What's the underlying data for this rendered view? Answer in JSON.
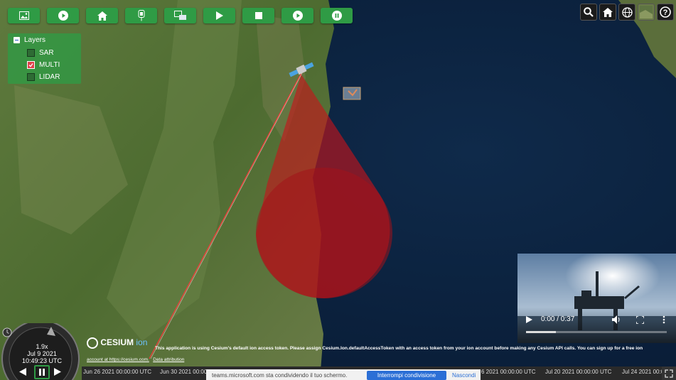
{
  "toolbar": {
    "buttons": [
      {
        "name": "image-icon"
      },
      {
        "name": "play-circle-icon"
      },
      {
        "name": "home-icon"
      },
      {
        "name": "sensor-icon"
      },
      {
        "name": "satellite-image-icon"
      },
      {
        "name": "play-icon"
      },
      {
        "name": "stop-icon"
      },
      {
        "name": "play-circle-icon"
      },
      {
        "name": "pause-circle-icon"
      }
    ],
    "color": "#2f9b45"
  },
  "nav_icons": [
    "search-icon",
    "home-icon",
    "globe-icon",
    "base-layer-picker-icon",
    "help-icon"
  ],
  "layers": {
    "title": "Layers",
    "items": [
      {
        "label": "SAR",
        "checked": false
      },
      {
        "label": "MULTI",
        "checked": true
      },
      {
        "label": "LIDAR",
        "checked": false
      }
    ]
  },
  "animation": {
    "speed": "1.9x",
    "date": "Jul 9 2021",
    "time": "10:49:23 UTC"
  },
  "cesium": {
    "logo_text": "CESIUM",
    "logo_suffix": "ion",
    "token_message": "This application is using Cesium's default ion access token. Please assign Cesium.Ion.defaultAccessToken with an access token from your ion account before making any Cesium API calls. You can sign up for a free ion",
    "account_link": "account at https://cesium.com.",
    "data_attribution": "Data attribution"
  },
  "video": {
    "time": "0:00 / 0:37",
    "progress": 0.0
  },
  "timeline": {
    "ticks": [
      "Jun 26 2021 00:00:00 UTC",
      "Jun 30 2021 00:00:00 UTC",
      "6 2021 00:00:00 UTC",
      "Jul 20 2021 00:00:00 UTC",
      "Jul 24 2021 00:00:00 UTC"
    ]
  },
  "share_banner": {
    "text": "teams.microsoft.com sta condividendo il tuo schermo.",
    "stop_button": "Interrompi condivisione",
    "hide_button": "Nascondi"
  },
  "colors": {
    "sensor_cone": "#d01a1a",
    "checkbox_checked": "#e0424c",
    "ocean": "#0b2340"
  }
}
